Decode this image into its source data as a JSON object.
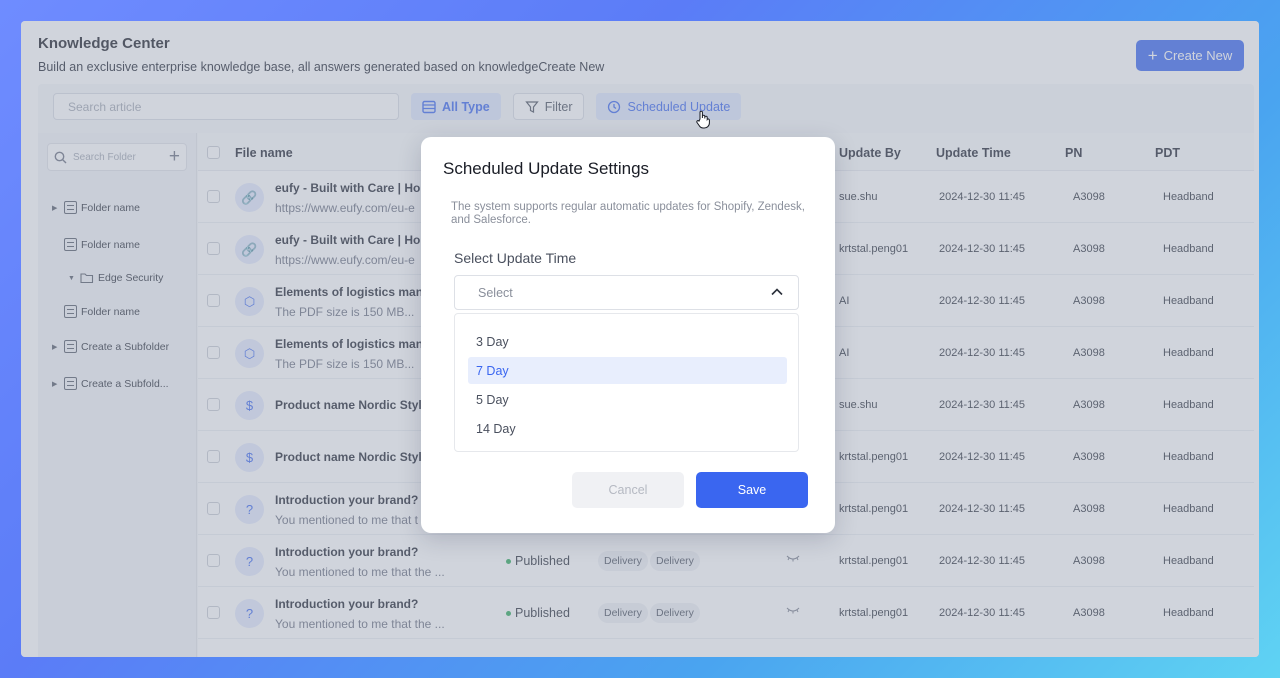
{
  "header": {
    "title": "Knowledge Center",
    "subtitle": "Build an exclusive enterprise knowledge base, all answers generated based on knowledgeCreate New",
    "create_label": "Create New"
  },
  "toolbar": {
    "search_placeholder": "Search article",
    "all_type_label": "All Type",
    "filter_label": "Filter",
    "scheduled_label": "Scheduled Update"
  },
  "sidebar": {
    "search_placeholder": "Search Folder",
    "items": [
      {
        "label": "Folder name",
        "caret": "▶"
      },
      {
        "label": "Folder name",
        "caret": ""
      },
      {
        "label": "Edge Security",
        "caret": "▼"
      },
      {
        "label": "Folder name",
        "caret": ""
      },
      {
        "label": "Create a Subfolder",
        "caret": "▶"
      },
      {
        "label": "Create a Subfold...",
        "caret": "▶"
      }
    ]
  },
  "table": {
    "columns": {
      "file_name": "File name",
      "update_by": "Update By",
      "update_time": "Update Time",
      "pn": "PN",
      "pdt": "PDT"
    },
    "rows": [
      {
        "icon": "link-icon",
        "name": "eufy - Built with Care | Hor",
        "desc": "https://www.eufy.com/eu-e",
        "status": "",
        "tags": [],
        "update_by": "sue.shu",
        "time": "2024-12-30 11:45",
        "pn": "A3098",
        "pdt": "Headband"
      },
      {
        "icon": "link-icon",
        "name": "eufy - Built with Care | Hor",
        "desc": "https://www.eufy.com/eu-e",
        "status": "",
        "tags": [],
        "update_by": "krtstal.peng01",
        "time": "2024-12-30 11:45",
        "pn": "A3098",
        "pdt": "Headband"
      },
      {
        "icon": "package-icon",
        "name": "Elements of logistics mana",
        "desc": "The PDF size is 150 MB...",
        "status": "",
        "tags": [],
        "update_by": "AI",
        "time": "2024-12-30 11:45",
        "pn": "A3098",
        "pdt": "Headband"
      },
      {
        "icon": "package-icon",
        "name": "Elements of logistics mana",
        "desc": "The PDF size is 150 MB...",
        "status": "",
        "tags": [],
        "update_by": "AI",
        "time": "2024-12-30 11:45",
        "pn": "A3098",
        "pdt": "Headband"
      },
      {
        "icon": "shopping-bag-icon",
        "name": "Product name Nordic Style",
        "desc": "",
        "status": "",
        "tags": [],
        "update_by": "sue.shu",
        "time": "2024-12-30 11:45",
        "pn": "A3098",
        "pdt": "Headband"
      },
      {
        "icon": "shopping-bag-icon",
        "name": "Product name Nordic Style",
        "desc": "",
        "status": "",
        "tags": [],
        "update_by": "krtstal.peng01",
        "time": "2024-12-30 11:45",
        "pn": "A3098",
        "pdt": "Headband"
      },
      {
        "icon": "question-icon",
        "name": "Introduction your brand?",
        "desc": "You mentioned to me that t",
        "status": "",
        "tags": [],
        "update_by": "krtstal.peng01",
        "time": "2024-12-30 11:45",
        "pn": "A3098",
        "pdt": "Headband"
      },
      {
        "icon": "question-icon",
        "name": "Introduction your brand?",
        "desc": "You mentioned to me that the ...",
        "status": "Published",
        "tags": [
          "Delivery",
          "Delivery"
        ],
        "update_by": "krtstal.peng01",
        "time": "2024-12-30 11:45",
        "pn": "A3098",
        "pdt": "Headband"
      },
      {
        "icon": "question-icon",
        "name": "Introduction your brand?",
        "desc": "You mentioned to me that the ...",
        "status": "Published",
        "tags": [
          "Delivery",
          "Delivery"
        ],
        "update_by": "krtstal.peng01",
        "time": "2024-12-30 11:45",
        "pn": "A3098",
        "pdt": "Headband"
      }
    ]
  },
  "modal": {
    "title": "Scheduled Update Settings",
    "description": "The system supports regular automatic updates for Shopify, Zendesk, and Salesforce.",
    "field_label": "Select Update Time",
    "select_placeholder": "Select",
    "options": [
      "3 Day",
      "7 Day",
      "5 Day",
      "14 Day"
    ],
    "selected_option": "7 Day",
    "cancel_label": "Cancel",
    "save_label": "Save"
  },
  "colors": {
    "accent": "#3a66f0",
    "published": "#2eaa5b"
  }
}
